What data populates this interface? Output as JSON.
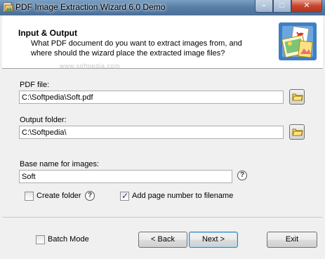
{
  "window": {
    "title": "PDF Image Extraction Wizard 6.0 Demo",
    "controls": {
      "minimize": "–",
      "maximize": "□",
      "close": "✕"
    }
  },
  "header": {
    "title": "Input & Output",
    "description": "What PDF document do you want to extract images from, and where should the wizard place the extracted image files?",
    "watermark": "www.softpedia.com",
    "logo_icon": "pdf-images-icon"
  },
  "form": {
    "pdf_file": {
      "label": "PDF file:",
      "value": "C:\\Softpedia\\Soft.pdf",
      "browse_icon": "folder-icon"
    },
    "output_folder": {
      "label": "Output folder:",
      "value": "C:\\Softpedia\\",
      "browse_icon": "folder-icon"
    },
    "base_name": {
      "label": "Base name for images:",
      "value": "Soft",
      "help": "?"
    },
    "create_folder": {
      "label": "Create folder",
      "checked": false,
      "help": "?"
    },
    "add_page_number": {
      "label": "Add page number to filename",
      "checked": true
    }
  },
  "footer": {
    "batch_mode": {
      "label": "Batch Mode",
      "checked": false
    },
    "back_label": "< Back",
    "next_label": "Next >",
    "exit_label": "Exit"
  },
  "colors": {
    "accent": "#3c7fb1",
    "titlebar": "#5a7fa6",
    "close": "#c7452d"
  }
}
